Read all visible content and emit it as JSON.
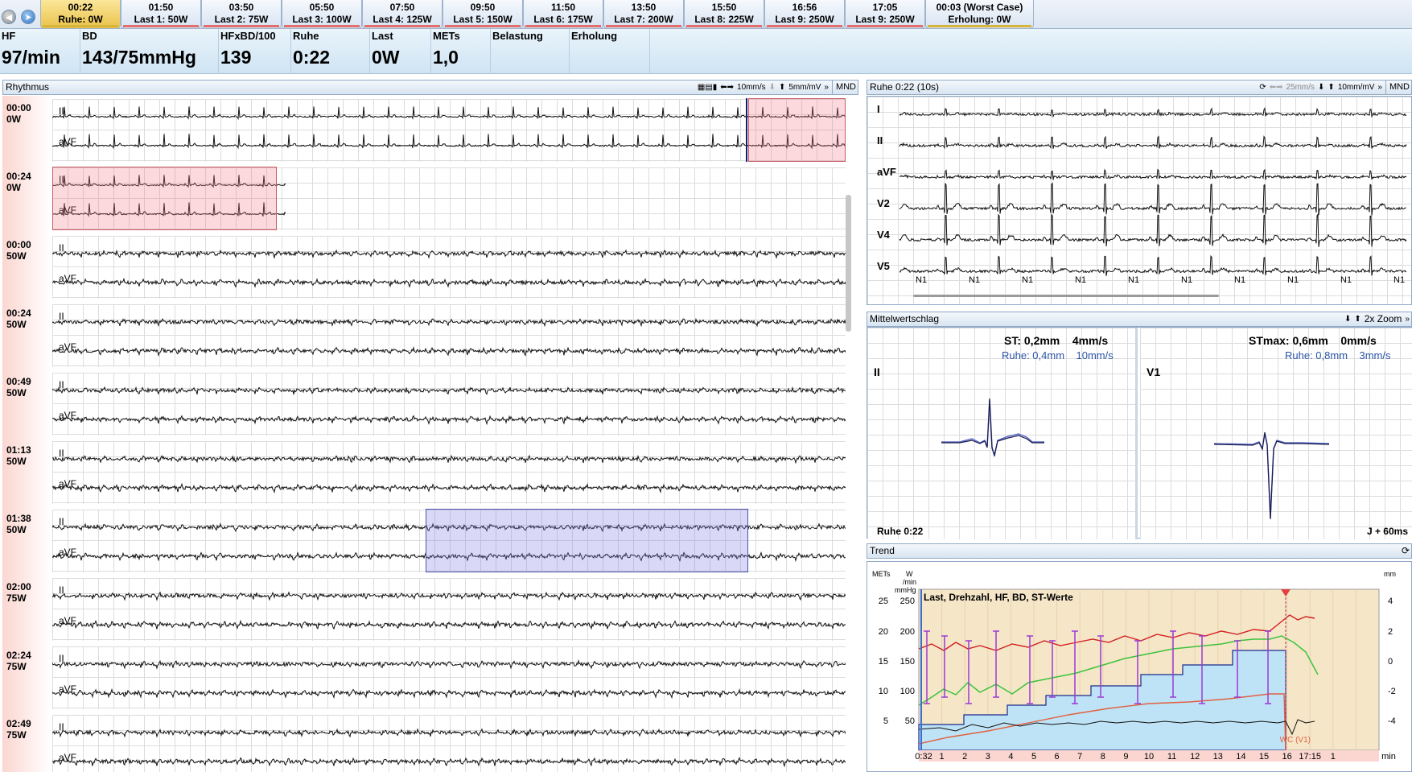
{
  "nav": {
    "back_icon": "arrow-left-icon",
    "forward_icon": "arrow-right-icon"
  },
  "stages": [
    {
      "time": "00:22",
      "label": "Ruhe: 0W",
      "active": true
    },
    {
      "time": "01:50",
      "label": "Last 1: 50W"
    },
    {
      "time": "03:50",
      "label": "Last 2: 75W"
    },
    {
      "time": "05:50",
      "label": "Last 3: 100W"
    },
    {
      "time": "07:50",
      "label": "Last 4: 125W"
    },
    {
      "time": "09:50",
      "label": "Last 5: 150W"
    },
    {
      "time": "11:50",
      "label": "Last 6: 175W"
    },
    {
      "time": "13:50",
      "label": "Last 7: 200W"
    },
    {
      "time": "15:50",
      "label": "Last 8: 225W"
    },
    {
      "time": "16:56",
      "label": "Last 9: 250W"
    },
    {
      "time": "17:05",
      "label": "Last 9: 250W"
    },
    {
      "time": "00:03 (Worst Case)",
      "label": "Erholung: 0W"
    }
  ],
  "values": [
    {
      "label": "HF",
      "value": "97/min"
    },
    {
      "label": "BD",
      "value": "143/75mmHg"
    },
    {
      "label": "HFxBD/100",
      "value": "139"
    },
    {
      "label": "Ruhe",
      "value": "0:22"
    },
    {
      "label": "Last",
      "value": "0W"
    },
    {
      "label": "METs",
      "value": "1,0"
    },
    {
      "label": "Belastung",
      "value": ""
    },
    {
      "label": "Erholung",
      "value": ""
    }
  ],
  "rhythm": {
    "title": "Rhythmus",
    "speed": "10mm/s",
    "gain": "5mm/mV",
    "mnd": "MND",
    "rows": [
      {
        "time": "00:00",
        "load": "0W"
      },
      {
        "time": "00:24",
        "load": "0W"
      },
      {
        "time": "00:00",
        "load": "50W"
      },
      {
        "time": "00:24",
        "load": "50W"
      },
      {
        "time": "00:49",
        "load": "50W"
      },
      {
        "time": "01:13",
        "load": "50W"
      },
      {
        "time": "01:38",
        "load": "50W"
      },
      {
        "time": "02:00",
        "load": "75W"
      },
      {
        "time": "02:24",
        "load": "75W"
      },
      {
        "time": "02:49",
        "load": "75W"
      }
    ],
    "leads": [
      "II",
      "aVF"
    ]
  },
  "ecg10": {
    "title": "Ruhe 0:22 (10s)",
    "speed": "25mm/s",
    "gain": "10mm/mV",
    "mnd": "MND",
    "leads": [
      "I",
      "II",
      "aVF",
      "V2",
      "V4",
      "V5"
    ],
    "beat_label": "N1"
  },
  "avg": {
    "title": "Mittelwertschlag",
    "zoom": "2x Zoom",
    "left": {
      "lead": "II",
      "st": "ST:  0,2mm",
      "slope": "4mm/s",
      "rest_st": "Ruhe: 0,4mm",
      "rest_slope": "10mm/s",
      "footer": "Ruhe 0:22"
    },
    "right": {
      "lead": "V1",
      "st": "STmax:  0,6mm",
      "slope": "0mm/s",
      "rest_st": "Ruhe: 0,8mm",
      "rest_slope": "3mm/s",
      "footer": "J + 60ms"
    }
  },
  "trend": {
    "title": "Trend",
    "chart_title": "Last, Drehzahl, HF, BD, ST-Werte",
    "axis_mets": "METs",
    "axis_w": "W",
    "axis_w2": "/min",
    "axis_mmhg": "mmHg",
    "axis_mm": "mm",
    "left_ticks_mets": [
      "25",
      "20",
      "15",
      "10",
      "5"
    ],
    "left_ticks_w": [
      "250",
      "200",
      "150",
      "100",
      "50"
    ],
    "right_ticks": [
      "4",
      "2",
      "0",
      "-2",
      "-4"
    ],
    "x_ticks": [
      "0:32",
      "1",
      "2",
      "3",
      "4",
      "5",
      "6",
      "7",
      "8",
      "9",
      "10",
      "11",
      "12",
      "13",
      "14",
      "15",
      "16",
      "17:15",
      "1",
      "min"
    ],
    "wc_label": "WC (V1)"
  },
  "colors": {
    "hr": "#d22020",
    "load_fill": "#c5e5f7",
    "load_line": "#1a2a8a",
    "mets": "#3cc33c",
    "bp": "#9b3ad6",
    "st": "#e06040",
    "grid": "#dcdcdc"
  }
}
